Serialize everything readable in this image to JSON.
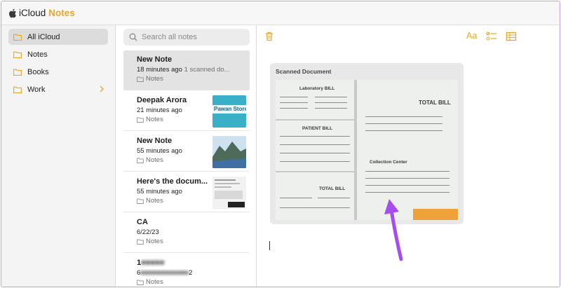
{
  "app": {
    "brand_a": "iCloud",
    "brand_b": "Notes"
  },
  "colors": {
    "accent": "#e6a92a",
    "selection": "#dcdcdc",
    "arrow": "#a54ded"
  },
  "sidebar": {
    "items": [
      {
        "label": "All iCloud",
        "icon": "folder-icon",
        "active": true
      },
      {
        "label": "Notes",
        "icon": "folder-icon"
      },
      {
        "label": "Books",
        "icon": "folder-icon"
      },
      {
        "label": "Work",
        "icon": "folder-icon",
        "expandable": true
      }
    ]
  },
  "search": {
    "placeholder": "Search all notes"
  },
  "notes": [
    {
      "title": "New Note",
      "time": "18 minutes ago",
      "preview": "1 scanned do...",
      "folder": "Notes",
      "active": true
    },
    {
      "title": "Deepak Arora",
      "time": "21 minutes ago",
      "preview": "",
      "folder": "Notes",
      "thumb_text": "Pawan Store"
    },
    {
      "title": "New Note",
      "time": "55 minutes ago",
      "preview": "",
      "folder": "Notes"
    },
    {
      "title": "Here's the docum...",
      "time": "55 minutes ago",
      "preview": "",
      "folder": "Notes"
    },
    {
      "title": "CA",
      "time": "6/22/23",
      "preview": "",
      "folder": "Notes"
    },
    {
      "title": "1",
      "time": "6",
      "time_end": "2",
      "preview": "",
      "folder": "Notes",
      "blurred": true
    }
  ],
  "editor": {
    "format_label": "Aa",
    "doc_label": "Scanned Document",
    "scan": {
      "left_top_title": "Laboratory BILL",
      "left_mid_title": "PATIENT BILL",
      "left_bottom_title": "TOTAL BILL",
      "right_title": "TOTAL BILL",
      "right_sub": "Collection Center"
    }
  }
}
